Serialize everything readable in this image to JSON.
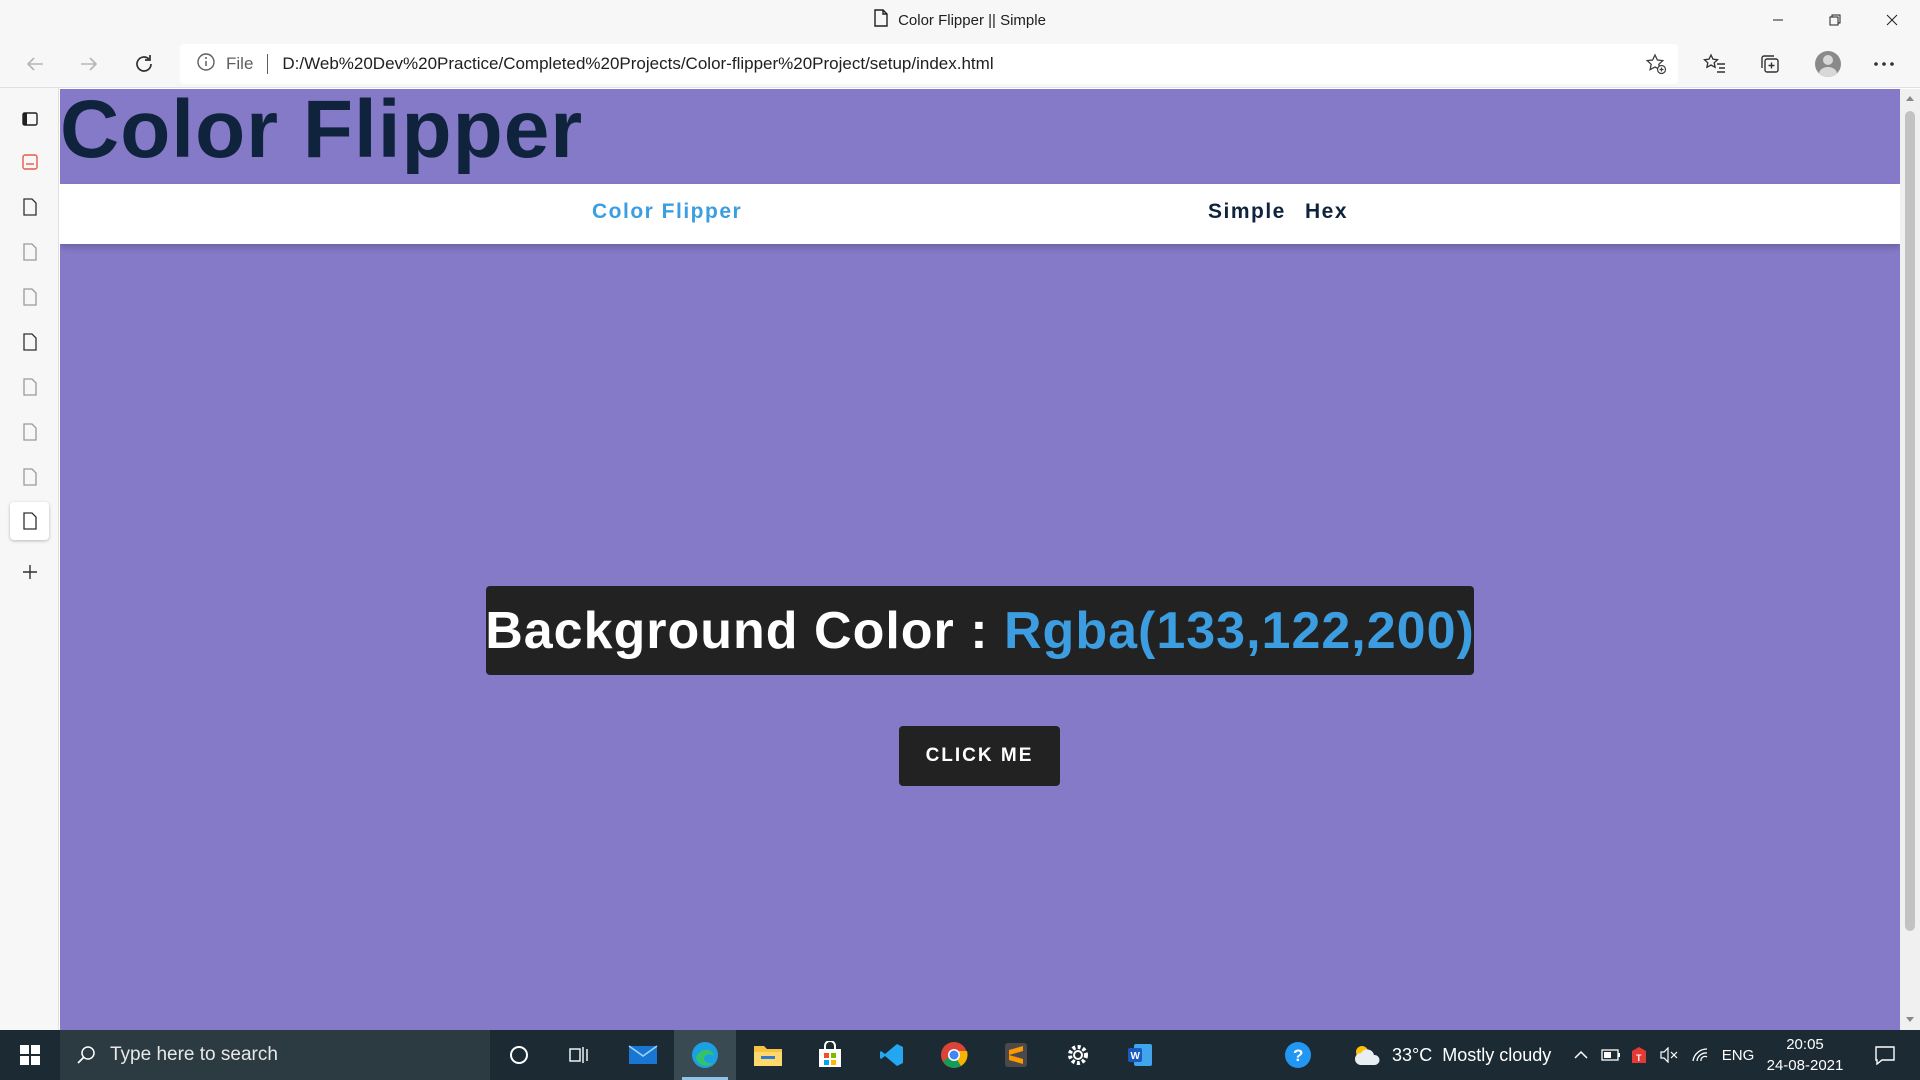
{
  "window": {
    "title": "Color Flipper || Simple",
    "page_icon": "page-icon"
  },
  "toolbar": {
    "file_label": "File",
    "url": "D:/Web%20Dev%20Practice/Completed%20Projects/Color-flipper%20Project/setup/index.html"
  },
  "page": {
    "title": "Color Flipper",
    "nav": {
      "brand": "Color Flipper",
      "links": [
        "Simple",
        "Hex"
      ]
    },
    "color_label": "Background Color : ",
    "color_value": "Rgba(133,122,200)",
    "button_label": "CLICK ME",
    "colors": {
      "background": "#857ac8",
      "title": "#10233d",
      "accent": "#3c9ee0",
      "dark": "#222222"
    }
  },
  "taskbar": {
    "search_placeholder": "Type here to search",
    "weather": "33°C  Mostly cloudy",
    "language": "ENG",
    "time": "20:05",
    "date": "24-08-2021"
  }
}
